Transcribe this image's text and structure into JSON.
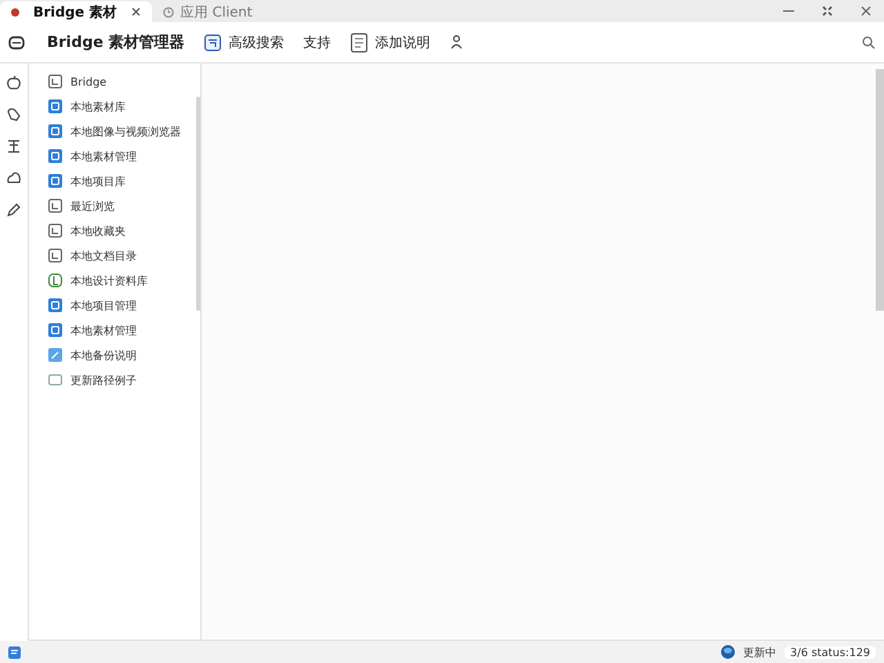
{
  "tabs": [
    {
      "label": "Bridge 素材",
      "selected": true,
      "kind": "dot"
    },
    {
      "label": "应用 Client",
      "selected": false,
      "kind": "clock"
    }
  ],
  "toolbar": {
    "app_title": "Bridge 素材管理器",
    "items": [
      {
        "label": "高级搜索",
        "kind": "calendar"
      },
      {
        "label": "支持",
        "kind": "none"
      },
      {
        "label": "添加说明",
        "kind": "note"
      }
    ]
  },
  "sidebar": {
    "items": [
      {
        "label": "Bridge",
        "kind": "outline",
        "selected": false
      },
      {
        "label": "本地素材库",
        "kind": "blue",
        "selected": false
      },
      {
        "label": "本地图像与视频浏览器",
        "kind": "blue",
        "selected": false
      },
      {
        "label": "本地素材管理",
        "kind": "blue",
        "selected": false
      },
      {
        "label": "本地项目库",
        "kind": "blue",
        "selected": false
      },
      {
        "label": "最近浏览",
        "kind": "outline",
        "selected": false
      },
      {
        "label": "本地收藏夹",
        "kind": "outline",
        "selected": false
      },
      {
        "label": "本地文档目录",
        "kind": "outline",
        "selected": false
      },
      {
        "label": "本地设计资料库",
        "kind": "green",
        "selected": false
      },
      {
        "label": "本地项目管理",
        "kind": "blue",
        "selected": false
      },
      {
        "label": "本地素材管理",
        "kind": "blue",
        "selected": false
      },
      {
        "label": "本地备份说明",
        "kind": "light",
        "selected": false
      },
      {
        "label": "更新路径例子",
        "kind": "plain",
        "selected": false
      }
    ]
  },
  "status_bar": {
    "sync": "更新中",
    "info": "3/6 status:129"
  }
}
